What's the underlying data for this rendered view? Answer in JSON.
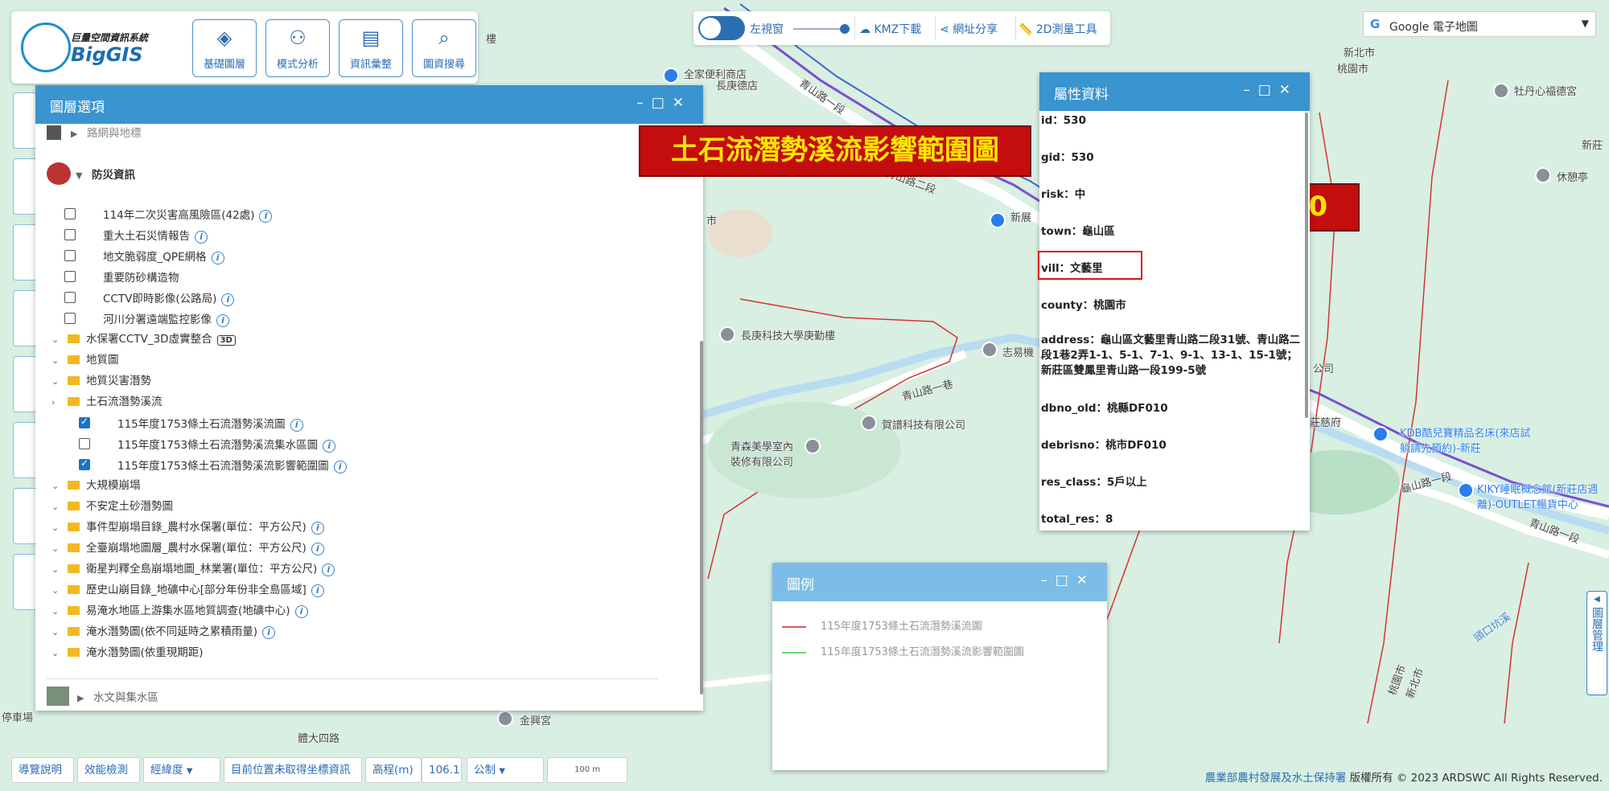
{
  "app": {
    "logo_title": "巨量空間資訊系統",
    "logo_name": "BigGIS",
    "tools": [
      {
        "label": "基礎圖層",
        "icon": "layers-icon"
      },
      {
        "label": "模式分析",
        "icon": "analysis-icon"
      },
      {
        "label": "資訊彙整",
        "icon": "document-map-icon"
      },
      {
        "label": "圖資搜尋",
        "icon": "map-search-icon"
      }
    ]
  },
  "top_controls": {
    "left_window": "左視窗",
    "kmz": "KMZ下載",
    "share": "網址分享",
    "measure": "2D測量工具"
  },
  "basemap_select": {
    "logo": "G",
    "value": "Google 電子地圖"
  },
  "layer_panel": {
    "title": "圖層選項",
    "sections": {
      "roads": "路網與地標",
      "disaster": "防災資訊",
      "hydro": "水文與集水區"
    },
    "checkbox_items": [
      {
        "label": "114年二次災害高風險區(42處)",
        "checked": false,
        "info": true
      },
      {
        "label": "重大土石災情報告",
        "checked": false,
        "info": true
      },
      {
        "label": "地文脆弱度_QPE網格",
        "checked": false,
        "info": true
      },
      {
        "label": "重要防砂構造物",
        "checked": false,
        "info": false
      },
      {
        "label": "CCTV即時影像(公路局)",
        "checked": false,
        "info": true
      },
      {
        "label": "河川分署遠端監控影像",
        "checked": false,
        "info": true
      }
    ],
    "folders_a": [
      {
        "label": "水保署CCTV_3D虛實整合",
        "badge": "3D"
      },
      {
        "label": "地質圖"
      },
      {
        "label": "地質災害潛勢"
      }
    ],
    "debris_folder": "土石流潛勢溪流",
    "debris_items": [
      {
        "label": "115年度1753條土石流潛勢溪流圖",
        "checked": true
      },
      {
        "label": "115年度1753條土石流潛勢溪流集水區圖",
        "checked": false
      },
      {
        "label": "115年度1753條土石流潛勢溪流影響範圍圖",
        "checked": true
      }
    ],
    "folders_b": [
      {
        "label": "大規模崩塌",
        "info": false
      },
      {
        "label": "不安定土砂潛勢圖",
        "info": false
      },
      {
        "label": "事件型崩塌目錄_農村水保署(單位：平方公尺)",
        "info": true
      },
      {
        "label": "全臺崩塌地圖層_農村水保署(單位：平方公尺)",
        "info": true
      },
      {
        "label": "衛星判釋全島崩塌地圖_林業署(單位：平方公尺)",
        "info": true
      },
      {
        "label": "歷史山崩目錄_地礦中心[部分年份非全島區域]",
        "info": true
      },
      {
        "label": "易淹水地區上游集水區地質調查(地礦中心)",
        "info": true
      },
      {
        "label": "淹水潛勢圖(依不同延時之累積雨量)",
        "info": true
      },
      {
        "label": "淹水潛勢圖(依重現期距)",
        "info": false
      }
    ]
  },
  "banners": {
    "main": "土石流潛勢溪流影響範圍圖",
    "code": "桃市DF010"
  },
  "attribute_panel": {
    "title": "屬性資料",
    "rows": [
      "id：530",
      "gid：530",
      "risk：中",
      "town：龜山區",
      "vill：文藝里",
      "county：桃園市",
      "address：龜山區文藝里青山路二段31號、青山路二段1巷2弄1-1、5-1、7-1、9-1、13-1、15-1號；新莊區雙鳳里青山路一段199-5號",
      "dbno_old：桃縣DF010",
      "debrisno：桃市DF010",
      "res_class：5戶以上",
      "total_res：8"
    ]
  },
  "legend": {
    "title": "圖例",
    "items": [
      {
        "label": "115年度1753條土石流潛勢溪流圖",
        "color": "#e05555"
      },
      {
        "label": "115年度1753條土石流潛勢溪流影響範圍圖",
        "color": "#66dd66"
      }
    ]
  },
  "bottom_bar": {
    "guide": "導覽說明",
    "perf": "效能檢測",
    "coord_type": "經緯度",
    "coord_status": "目前位置未取得坐標資訊",
    "elev_label": "高程(m)",
    "elev_value": "106.1",
    "unit": "公制",
    "scale": "100 m"
  },
  "copyright": {
    "org": "農業部農村發展及水土保持署",
    "text": " 版權所有 © 2023 ARDSWC All Rights Reserved."
  },
  "right_drawer": "圖層管理",
  "map_labels": [
    "全家便利商店",
    "長庚德店",
    "青山路一段",
    "青山路二段",
    "新北市",
    "桃園市",
    "牡丹心福德宮",
    "新莊",
    "休憩亭",
    "新展",
    "長庚科技大學庚勤樓",
    "志易機",
    "青山路一巷",
    "賀譜科技有限公司",
    "青森美學室內裝修有限公司",
    "公司",
    "莊慈府",
    "KDB酷兒寶精品名床(來店試躺請先預約)-新莊",
    "KIKY睡眠概念館(新莊店週離)-OUTLET暢貨中心",
    "青山路一段",
    "龜山路一段",
    "頭口坑溪",
    "桃園市",
    "新北市",
    "金興宮",
    "體大四路",
    "停車場",
    "樓",
    "市"
  ]
}
